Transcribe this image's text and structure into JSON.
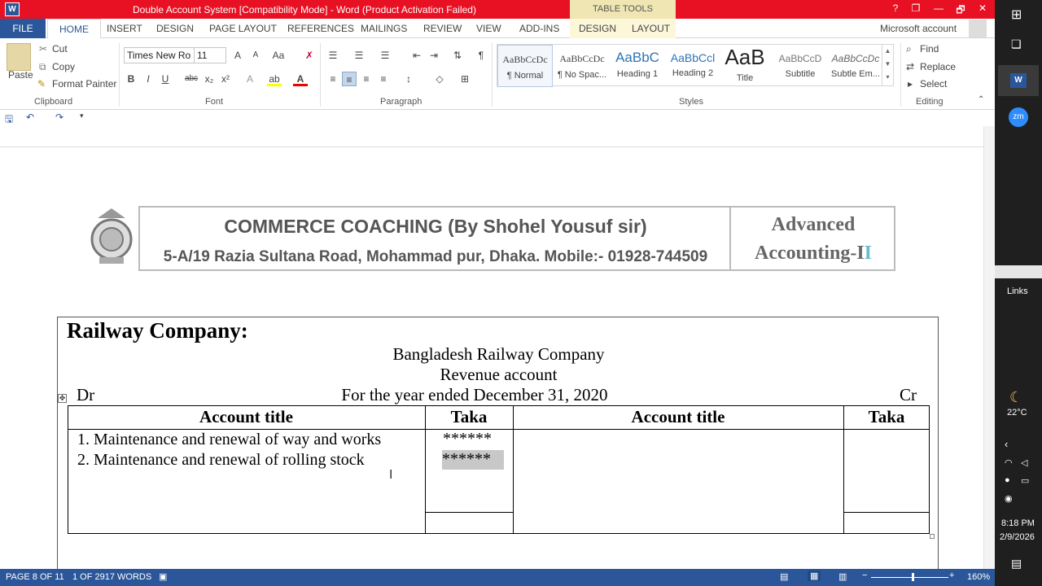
{
  "window": {
    "title": "Double Account System [Compatibility Mode] - Word (Product Activation Failed)",
    "app_icon": "W",
    "contextual": "TABLE TOOLS",
    "controls": [
      "?",
      "❐",
      "—",
      "🗗",
      "✕"
    ]
  },
  "tabs": [
    "FILE",
    "HOME",
    "INSERT",
    "DESIGN",
    "PAGE LAYOUT",
    "REFERENCES",
    "MAILINGS",
    "REVIEW",
    "VIEW",
    "ADD-INS",
    "DESIGN",
    "LAYOUT"
  ],
  "account": "Microsoft account",
  "clipboard": {
    "paste": "Paste",
    "cut": "Cut",
    "copy": "Copy",
    "format_painter": "Format Painter",
    "label": "Clipboard"
  },
  "font": {
    "name": "Times New Ro",
    "size": "11",
    "label": "Font"
  },
  "paragraph": {
    "label": "Paragraph"
  },
  "styles": {
    "label": "Styles",
    "items": [
      {
        "preview": "AaBbCcDc",
        "name": "¶ Normal"
      },
      {
        "preview": "AaBbCcDc",
        "name": "¶ No Spac..."
      },
      {
        "preview": "AaBbC",
        "name": "Heading 1"
      },
      {
        "preview": "AaBbCcl",
        "name": "Heading 2"
      },
      {
        "preview": "AaB",
        "name": "Title"
      },
      {
        "preview": "AaBbCcD",
        "name": "Subtitle"
      },
      {
        "preview": "AaBbCcDc",
        "name": "Subtle Em..."
      }
    ]
  },
  "editing": {
    "find": "Find",
    "replace": "Replace",
    "select": "Select",
    "label": "Editing"
  },
  "document": {
    "header_title": "COMMERCE COACHING (By Shohel Yousuf sir)",
    "header_address": "5-A/19 Razia Sultana Road, Mohammad pur, Dhaka. Mobile:- 01928-744509",
    "header_right_line1": "Advanced",
    "header_right_line2": "Accounting-I",
    "header_right_suffix": "I",
    "section_title": "Railway Company:",
    "company": "Bangladesh Railway Company",
    "statement": "Revenue account",
    "period": "For the year ended December 31, 2020",
    "dr": "Dr",
    "cr": "Cr",
    "table_headers": [
      "Account title",
      "Taka",
      "Account title",
      "Taka"
    ],
    "rows": [
      {
        "title": "1. Maintenance and renewal of way and works",
        "taka": "******"
      },
      {
        "title": "2. Maintenance and renewal of rolling stock",
        "taka": "******"
      }
    ]
  },
  "status": {
    "page": "PAGE 8 OF 11",
    "words": "1 OF 2917 WORDS",
    "zoom": "160%"
  },
  "taskbar": {
    "links": "Links",
    "temp": "22°C",
    "time": "8:18 PM",
    "date": "2/9/2026",
    "zoom_app": "zm"
  }
}
